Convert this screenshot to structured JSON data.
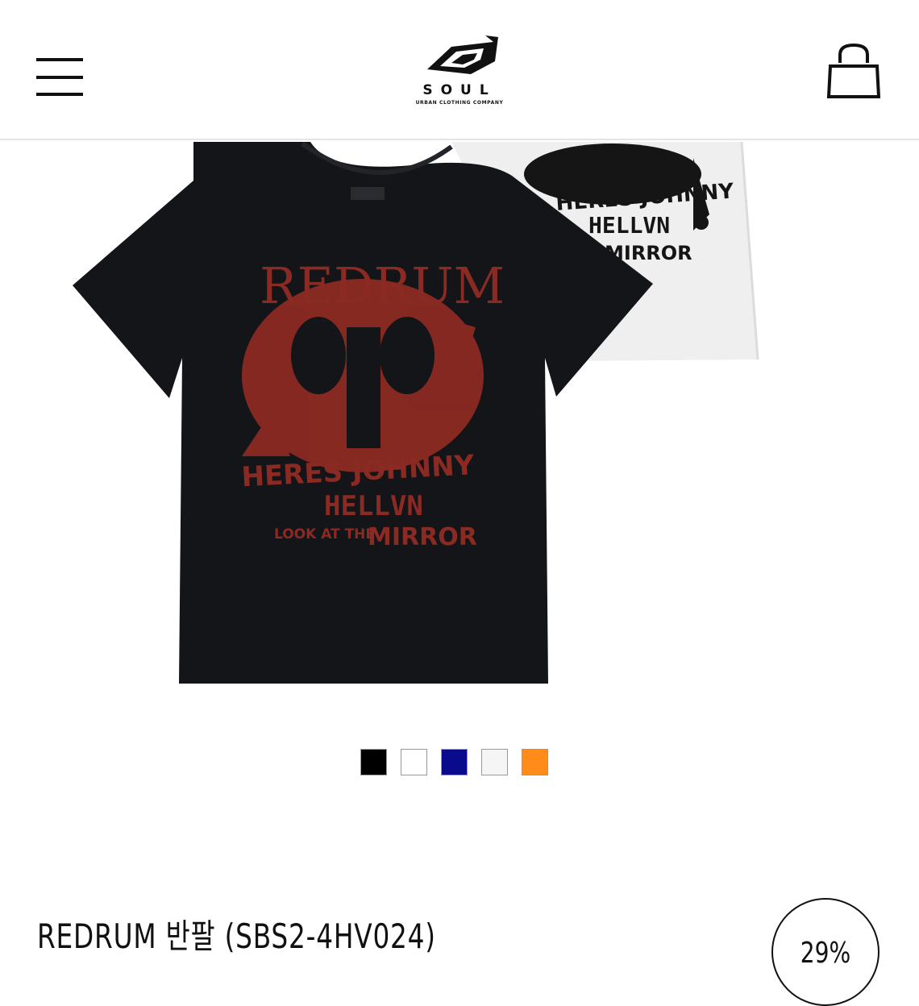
{
  "header": {
    "logo_text": "SOUL",
    "logo_subtext": "URBAN CLOTHING COMPANY",
    "menu_icon": "hamburger-menu-icon",
    "cart_icon": "shopping-bag-icon"
  },
  "product": {
    "title": "REDRUM 반팔 (SBS2-4HV024)",
    "discount": "29%",
    "main_shirt": {
      "color": "#141519",
      "print_color": "#8b2a22",
      "print_lines": [
        "REDRUM",
        "HERES JOHNNY",
        "HELLVN",
        "LOOK AT THE",
        "MIRROR"
      ]
    },
    "back_shirt": {
      "color": "#efefef",
      "print_color": "#151515",
      "print_lines": [
        "HERES JOHNNY",
        "HELLVN",
        "MIRROR"
      ]
    }
  },
  "swatches": [
    {
      "name": "black",
      "color": "#000000"
    },
    {
      "name": "white",
      "color": "#ffffff"
    },
    {
      "name": "navy",
      "color": "#0a0a8c"
    },
    {
      "name": "light-gray",
      "color": "#f5f5f5"
    },
    {
      "name": "orange",
      "color": "#ff8c1a"
    }
  ]
}
